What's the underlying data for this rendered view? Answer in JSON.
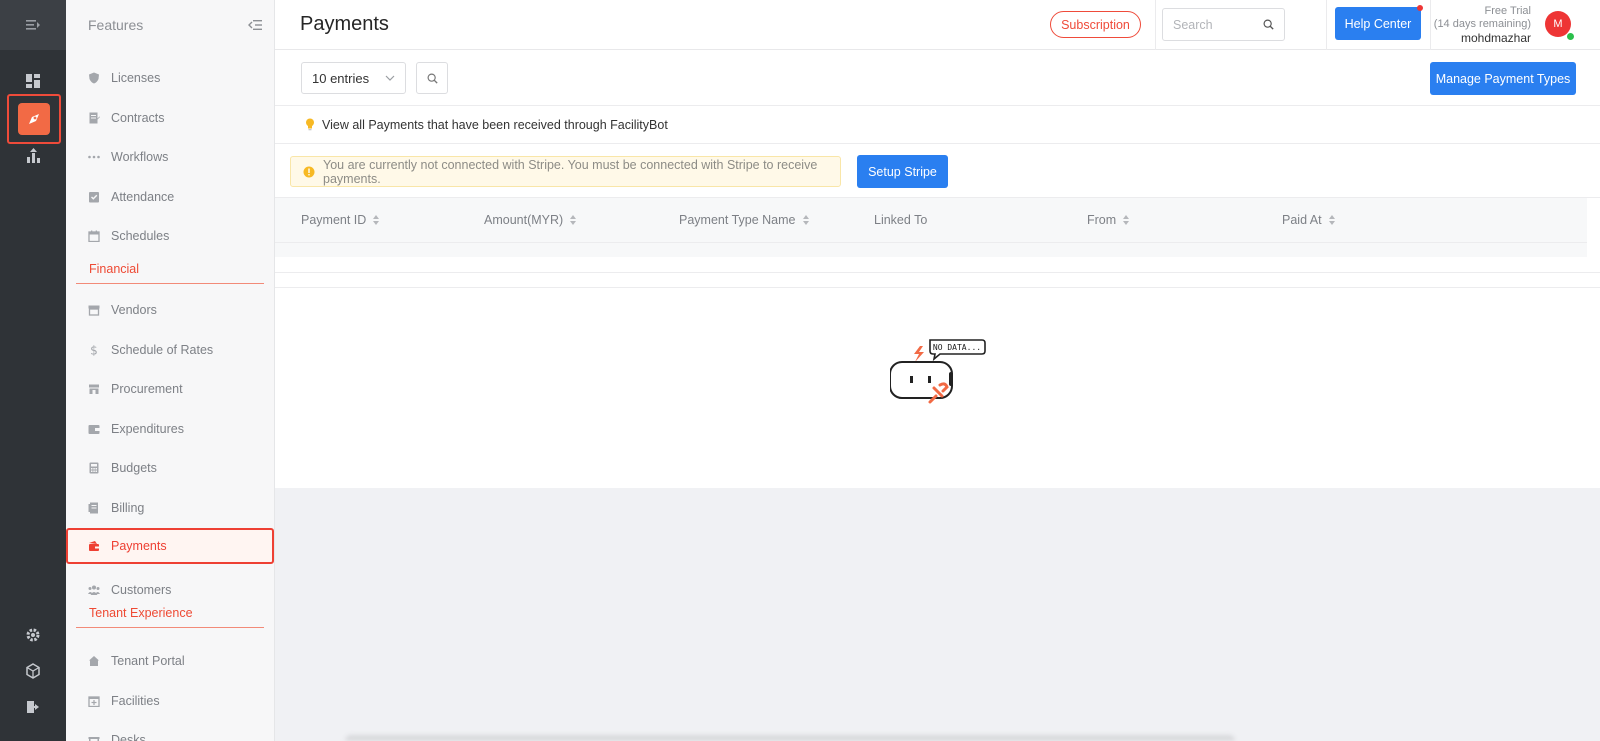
{
  "sidebar": {
    "title": "Features",
    "items": [
      {
        "label": "Licenses",
        "icon": "shield-icon"
      },
      {
        "label": "Contracts",
        "icon": "contract-icon"
      },
      {
        "label": "Workflows",
        "icon": "dots-icon"
      },
      {
        "label": "Attendance",
        "icon": "checklist-icon"
      },
      {
        "label": "Schedules",
        "icon": "calendar-icon"
      },
      {
        "label": "Vendors",
        "icon": "store-icon"
      },
      {
        "label": "Schedule of Rates",
        "icon": "dollar-icon"
      },
      {
        "label": "Procurement",
        "icon": "shop-icon"
      },
      {
        "label": "Expenditures",
        "icon": "wallet-icon"
      },
      {
        "label": "Budgets",
        "icon": "calculator-icon"
      },
      {
        "label": "Billing",
        "icon": "receipt-icon"
      },
      {
        "label": "Payments",
        "icon": "payment-icon"
      },
      {
        "label": "Customers",
        "icon": "people-icon"
      },
      {
        "label": "Tenant Portal",
        "icon": "home-icon"
      },
      {
        "label": "Facilities",
        "icon": "calendar-plus-icon"
      },
      {
        "label": "Desks",
        "icon": "desk-icon"
      }
    ],
    "sections": {
      "financial": "Financial",
      "tenant": "Tenant Experience"
    }
  },
  "header": {
    "title": "Payments",
    "subscription_label": "Subscription",
    "search_placeholder": "Search",
    "help_label": "Help Center",
    "trial_line1": "Free Trial",
    "trial_line2": "(14 days remaining)",
    "username": "mohdmazhar",
    "avatar_initial": "M"
  },
  "toolbar": {
    "entries_value": "10 entries",
    "manage_label": "Manage Payment Types"
  },
  "info_text": "View all Payments that have been received through FacilityBot",
  "warning": {
    "text": "You are currently not connected with Stripe. You must be connected with Stripe to receive payments.",
    "button": "Setup Stripe"
  },
  "table": {
    "columns": [
      "Payment ID",
      "Amount(MYR)",
      "Payment Type Name",
      "Linked To",
      "From",
      "Paid At"
    ]
  },
  "empty": {
    "text": "NO DATA..."
  },
  "colors": {
    "accent": "#2a7ff0",
    "brand": "#ef4b3a",
    "rail": "#2f3337"
  }
}
